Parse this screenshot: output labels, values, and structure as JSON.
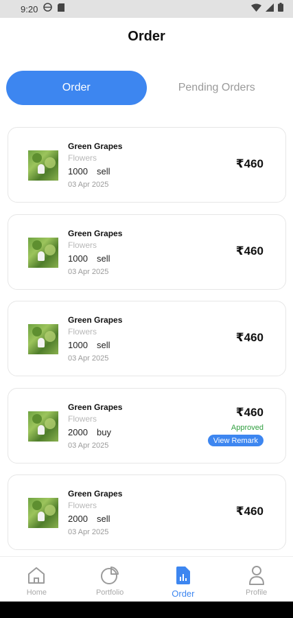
{
  "status_bar": {
    "time": "9:20",
    "left_icons": [
      "globe-icon",
      "sim-card-icon"
    ],
    "right_icons": [
      "wifi-icon",
      "signal-icon",
      "battery-icon"
    ]
  },
  "header": {
    "title": "Order"
  },
  "tabs": [
    {
      "label": "Order",
      "active": true
    },
    {
      "label": "Pending Orders",
      "active": false
    }
  ],
  "orders": [
    {
      "name": "Green Grapes",
      "category": "Flowers",
      "quantity": "1000",
      "type": "sell",
      "date": "03 Apr 2025",
      "price": "₹460"
    },
    {
      "name": "Green Grapes",
      "category": "Flowers",
      "quantity": "1000",
      "type": "sell",
      "date": "03 Apr 2025",
      "price": "₹460"
    },
    {
      "name": "Green Grapes",
      "category": "Flowers",
      "quantity": "1000",
      "type": "sell",
      "date": "03 Apr 2025",
      "price": "₹460"
    },
    {
      "name": "Green Grapes",
      "category": "Flowers",
      "quantity": "2000",
      "type": "buy",
      "date": "03 Apr 2025",
      "price": "₹460",
      "status": "Approved",
      "action_label": "View Remark"
    },
    {
      "name": "Green Grapes",
      "category": "Flowers",
      "quantity": "2000",
      "type": "sell",
      "date": "03 Apr 2025",
      "price": "₹460"
    }
  ],
  "bottom_nav": [
    {
      "label": "Home",
      "icon": "home-icon",
      "active": false
    },
    {
      "label": "Portfolio",
      "icon": "pie-chart-icon",
      "active": false
    },
    {
      "label": "Order",
      "icon": "order-document-icon",
      "active": true
    },
    {
      "label": "Profile",
      "icon": "user-icon",
      "active": false
    }
  ],
  "colors": {
    "accent": "#3d86f0",
    "approved": "#2e9e3e",
    "muted_text": "#9a9a9a",
    "card_border": "#e6e6e6"
  }
}
